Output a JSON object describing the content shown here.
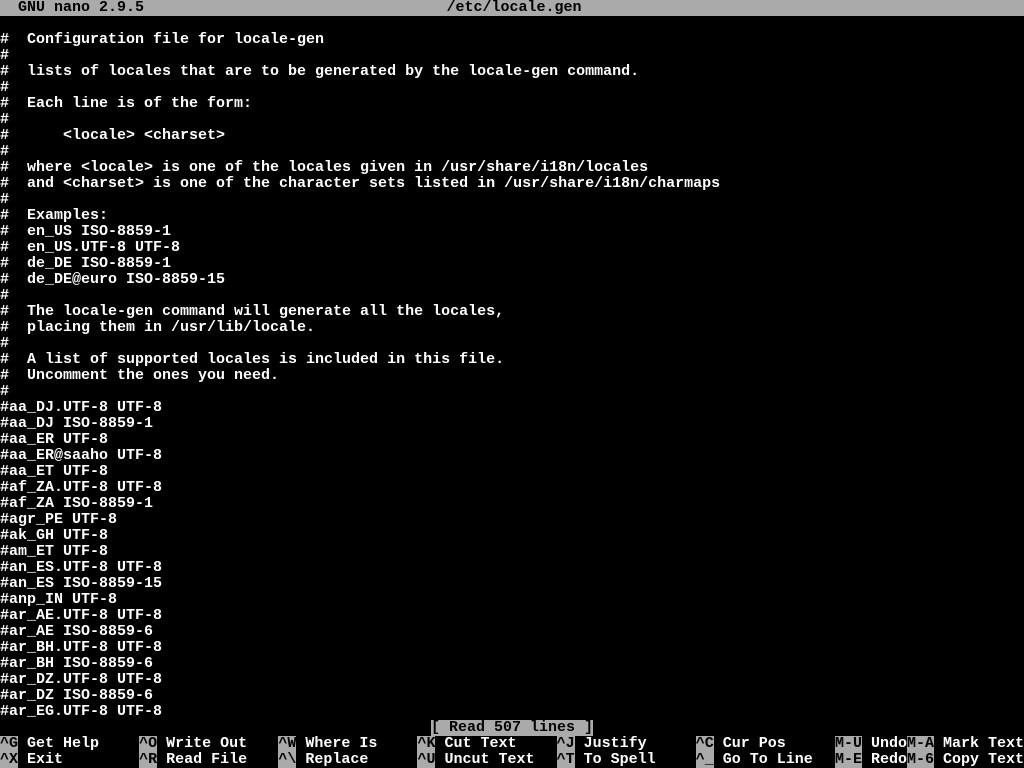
{
  "title": {
    "app": "  GNU nano 2.9.5",
    "file": "/etc/locale.gen"
  },
  "lines": [
    "#  Configuration file for locale-gen",
    "#",
    "#  lists of locales that are to be generated by the locale-gen command.",
    "#",
    "#  Each line is of the form:",
    "#",
    "#      <locale> <charset>",
    "#",
    "#  where <locale> is one of the locales given in /usr/share/i18n/locales",
    "#  and <charset> is one of the character sets listed in /usr/share/i18n/charmaps",
    "#",
    "#  Examples:",
    "#  en_US ISO-8859-1",
    "#  en_US.UTF-8 UTF-8",
    "#  de_DE ISO-8859-1",
    "#  de_DE@euro ISO-8859-15",
    "#",
    "#  The locale-gen command will generate all the locales,",
    "#  placing them in /usr/lib/locale.",
    "#",
    "#  A list of supported locales is included in this file.",
    "#  Uncomment the ones you need.",
    "#",
    "#aa_DJ.UTF-8 UTF-8",
    "#aa_DJ ISO-8859-1",
    "#aa_ER UTF-8",
    "#aa_ER@saaho UTF-8",
    "#aa_ET UTF-8",
    "#af_ZA.UTF-8 UTF-8",
    "#af_ZA ISO-8859-1",
    "#agr_PE UTF-8",
    "#ak_GH UTF-8",
    "#am_ET UTF-8",
    "#an_ES.UTF-8 UTF-8",
    "#an_ES ISO-8859-15",
    "#anp_IN UTF-8",
    "#ar_AE.UTF-8 UTF-8",
    "#ar_AE ISO-8859-6",
    "#ar_BH.UTF-8 UTF-8",
    "#ar_BH ISO-8859-6",
    "#ar_DZ.UTF-8 UTF-8",
    "#ar_DZ ISO-8859-6",
    "#ar_EG.UTF-8 UTF-8"
  ],
  "status": "[ Read 507 lines ]",
  "shortcuts": [
    {
      "key": "^G",
      "label": " Get Help"
    },
    {
      "key": "^X",
      "label": " Exit"
    },
    {
      "key": "^O",
      "label": " Write Out"
    },
    {
      "key": "^R",
      "label": " Read File"
    },
    {
      "key": "^W",
      "label": " Where Is"
    },
    {
      "key": "^\\",
      "label": " Replace"
    },
    {
      "key": "^K",
      "label": " Cut Text"
    },
    {
      "key": "^U",
      "label": " Uncut Text"
    },
    {
      "key": "^J",
      "label": " Justify"
    },
    {
      "key": "^T",
      "label": " To Spell"
    },
    {
      "key": "^C",
      "label": " Cur Pos"
    },
    {
      "key": "^_",
      "label": " Go To Line"
    },
    {
      "key": "M-U",
      "label": " Undo"
    },
    {
      "key": "M-E",
      "label": " Redo"
    },
    {
      "key": "M-A",
      "label": " Mark Text"
    },
    {
      "key": "M-6",
      "label": " Copy Text"
    }
  ]
}
